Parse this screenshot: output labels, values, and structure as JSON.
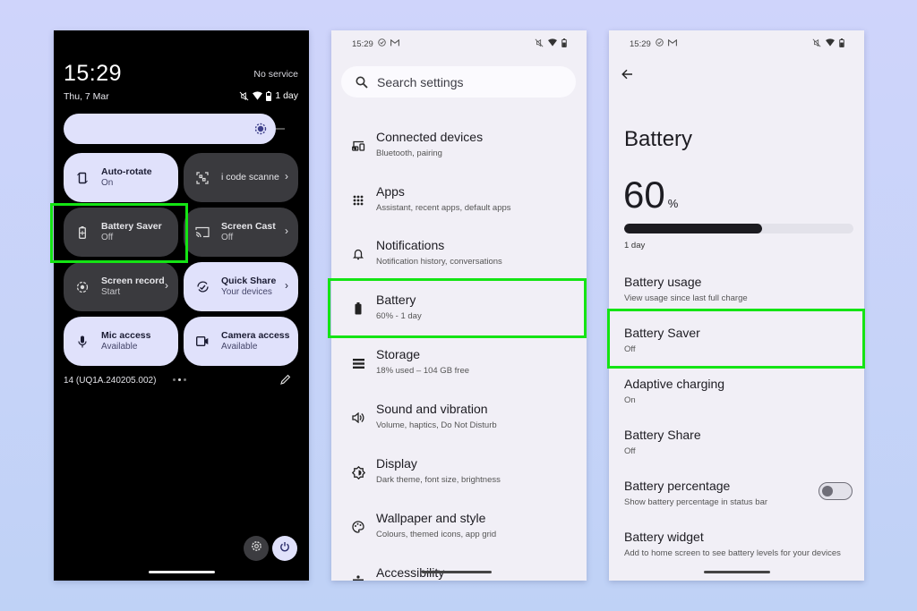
{
  "quick_settings": {
    "time": "15:29",
    "date": "Thu, 7 Mar",
    "carrier": "No service",
    "battery_estimate": "1 day",
    "tiles": [
      {
        "title": "Auto-rotate",
        "subtitle": "On",
        "state": "on",
        "icon": "screen-rotation-icon"
      },
      {
        "title": "i code scanne",
        "subtitle": "",
        "state": "off",
        "icon": "qr-scanner-icon",
        "has_chevron": true
      },
      {
        "title": "Battery Saver",
        "subtitle": "Off",
        "state": "off",
        "icon": "battery-saver-icon"
      },
      {
        "title": "Screen Cast",
        "subtitle": "Off",
        "state": "off",
        "icon": "cast-icon",
        "has_chevron": true
      },
      {
        "title": "Screen record",
        "subtitle": "Start",
        "state": "off",
        "icon": "screen-record-icon",
        "has_chevron": true
      },
      {
        "title": "Quick Share",
        "subtitle": "Your devices",
        "state": "on",
        "icon": "quick-share-icon",
        "has_chevron": true
      },
      {
        "title": "Mic access",
        "subtitle": "Available",
        "state": "on",
        "icon": "mic-icon"
      },
      {
        "title": "Camera access",
        "subtitle": "Available",
        "state": "on",
        "icon": "camera-icon"
      }
    ],
    "chevron": "›",
    "build_number": "14 (UQ1A.240205.002)",
    "page_indicator": {
      "pages": 3,
      "current": 2
    }
  },
  "settings": {
    "status_time": "15:29",
    "search_placeholder": "Search settings",
    "items": [
      {
        "title": "Connected devices",
        "subtitle": "Bluetooth, pairing",
        "icon": "connected-devices-icon"
      },
      {
        "title": "Apps",
        "subtitle": "Assistant, recent apps, default apps",
        "icon": "apps-grid-icon"
      },
      {
        "title": "Notifications",
        "subtitle": "Notification history, conversations",
        "icon": "bell-icon"
      },
      {
        "title": "Battery",
        "subtitle": "60% - 1 day",
        "icon": "battery-icon"
      },
      {
        "title": "Storage",
        "subtitle": "18% used – 104 GB free",
        "icon": "storage-icon"
      },
      {
        "title": "Sound and vibration",
        "subtitle": "Volume, haptics, Do Not Disturb",
        "icon": "volume-icon"
      },
      {
        "title": "Display",
        "subtitle": "Dark theme, font size, brightness",
        "icon": "display-brightness-icon"
      },
      {
        "title": "Wallpaper and style",
        "subtitle": "Colours, themed icons, app grid",
        "icon": "palette-icon"
      },
      {
        "title": "Accessibility",
        "subtitle": "",
        "icon": "accessibility-icon"
      }
    ]
  },
  "battery_page": {
    "status_time": "15:29",
    "title": "Battery",
    "level_value": "60",
    "level_symbol": "%",
    "level_fraction": 0.6,
    "estimate": "1 day",
    "items": [
      {
        "title": "Battery usage",
        "subtitle": "View usage since last full charge"
      },
      {
        "title": "Battery Saver",
        "subtitle": "Off"
      },
      {
        "title": "Adaptive charging",
        "subtitle": "On"
      },
      {
        "title": "Battery Share",
        "subtitle": "Off"
      },
      {
        "title": "Battery percentage",
        "subtitle": "Show battery percentage in status bar",
        "toggle": false
      },
      {
        "title": "Battery widget",
        "subtitle": "Add to home screen to see battery levels for your devices"
      }
    ]
  },
  "colors": {
    "highlight": "#14e414",
    "qs_tile_on": "#e0e1fb",
    "qs_tile_off": "#3a3a3e",
    "settings_bg": "#f1eff6"
  }
}
